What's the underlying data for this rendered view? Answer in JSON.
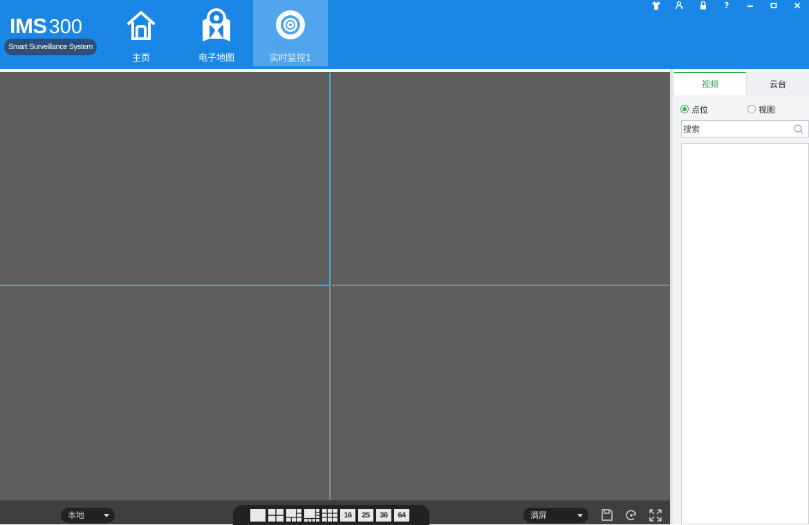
{
  "app": {
    "brand": "IMS",
    "model": "300",
    "subtitle": "Smart Surveillance System"
  },
  "nav": {
    "home_label": "主页",
    "map_label": "电子地图",
    "live_label": "实时监控1",
    "active": "live"
  },
  "window_controls": [
    "skin",
    "user",
    "lock",
    "help",
    "minimize",
    "maximize",
    "close"
  ],
  "window_labels": {
    "help": "?"
  },
  "video": {
    "cells": 4,
    "selected_cell": 1
  },
  "toolbar": {
    "source_select": "本地",
    "layouts": [
      {
        "icon": "layout-1-icon"
      },
      {
        "icon": "layout-4-icon"
      },
      {
        "icon": "layout-6-icon"
      },
      {
        "icon": "layout-8-icon"
      },
      {
        "icon": "layout-9-icon"
      },
      {
        "label": "16"
      },
      {
        "label": "25"
      },
      {
        "label": "36"
      },
      {
        "label": "64"
      }
    ],
    "display_select": "满屏",
    "icons": [
      "save-icon",
      "refresh-icon",
      "fullscreen-icon"
    ]
  },
  "panel": {
    "tab_video": "视频",
    "tab_ptz": "云台",
    "active_tab": "video",
    "radio_point": "点位",
    "radio_view": "视图",
    "radio_selected": "point",
    "search_placeholder": "搜索"
  },
  "colors": {
    "header": "#1a87e6",
    "active_nav": "#52a4ef",
    "accent_green": "#2fa84f",
    "video_bg": "#5e5e5e",
    "selected_border": "#4ba7d8"
  }
}
